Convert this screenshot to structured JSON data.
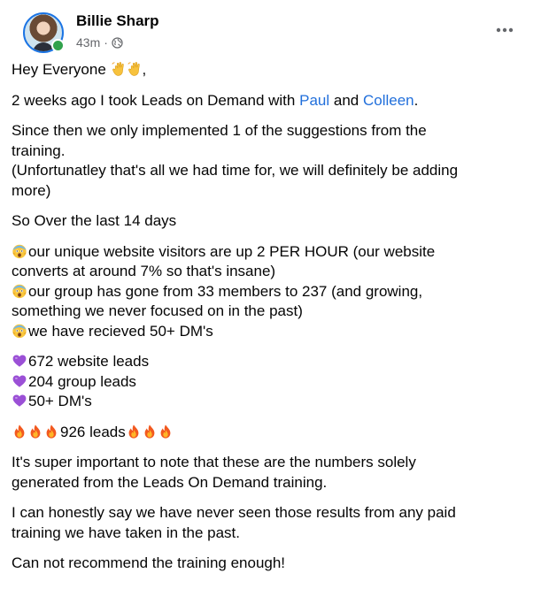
{
  "post": {
    "author": "Billie Sharp",
    "timestamp": "43m",
    "separator": "·",
    "icons": {
      "avatar": "profile-photo",
      "online": "online-status-dot",
      "audience": "globe-icon",
      "more": "more-options-icon",
      "wave": "waving-hand-emoji",
      "shock": "shocked-face-emoji",
      "heart": "purple-heart-emoji",
      "fire": "fire-emoji"
    },
    "colors": {
      "link": "#216fdb",
      "online": "#31a24c",
      "muted": "#65676b"
    },
    "greeting": "Hey Everyone",
    "greeting_end": ",",
    "intro_text": "2 weeks ago I took Leads on Demand with",
    "mention_1": "Paul",
    "and_text": "and",
    "mention_2": "Colleen",
    "period": ".",
    "since_line_1": "Since then we only implemented 1 of the suggestions from the",
    "since_line_2": "training.",
    "since_line_3": "(Unfortunatley that's all we had time for, we will definitely be adding",
    "since_line_4": "more)",
    "over_last": "So Over the last 14 days",
    "stat_1a": "our unique website visitors are up 2 PER HOUR (our website",
    "stat_1b": "converts at around 7% so that's insane)",
    "stat_2a": "our group has gone from 33 members to 237 (and growing,",
    "stat_2b": "something we never focused on in the past)",
    "stat_3": "we have recieved 50+ DM's",
    "lead_1": "672 website leads",
    "lead_2": "204 group leads",
    "lead_3": "50+ DM's",
    "total": "926 leads",
    "note_1": "It's super important to note that these are the numbers solely",
    "note_2": "generated from the Leads On Demand training.",
    "honest_1": "I can honestly say we have never seen those results from any paid",
    "honest_2": "training we have taken in the past.",
    "recommend": "Can not recommend the training enough!"
  }
}
